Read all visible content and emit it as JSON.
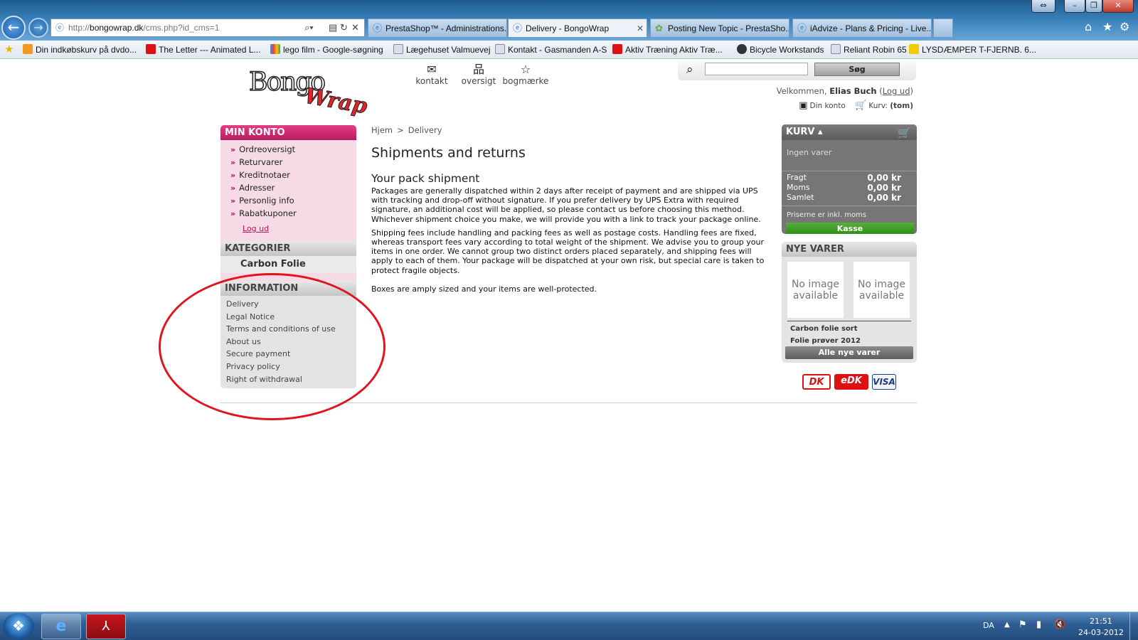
{
  "browser": {
    "address": {
      "prefix": "http://",
      "host": "bongowrap.dk",
      "path": "/cms.php?id_cms=1"
    },
    "tabs": [
      {
        "label": "PrestaShop™ - Administrations...",
        "active": false
      },
      {
        "label": "Delivery - BongoWrap",
        "active": true
      },
      {
        "label": "Posting New Topic - PrestaSho...",
        "active": false
      },
      {
        "label": "iAdvize - Plans & Pricing - Live...",
        "active": false
      }
    ],
    "favorites": [
      "Din indkøbskurv på dvdo...",
      "The Letter --- Animated L...",
      "lego film - Google-søgning",
      "Lægehuset Valmuevej",
      "Kontakt - Gasmanden A-S",
      "Aktiv Træning  Aktiv Træ...",
      "Bicycle Workstands",
      "Reliant Robin 65",
      "LYSDÆMPER T-FJERNB. 6..."
    ],
    "icons": [
      "back-icon",
      "forward-icon",
      "search-icon",
      "compatibility-icon",
      "refresh-icon",
      "stop-icon",
      "home-icon",
      "favorites-icon",
      "tools-icon"
    ]
  },
  "header": {
    "logo": {
      "part1": "Bongo",
      "part2": "Wrap"
    },
    "links": [
      {
        "label": "kontakt",
        "icon": "envelope-icon"
      },
      {
        "label": "oversigt",
        "icon": "sitemap-icon"
      },
      {
        "label": "bogmærke",
        "icon": "star-icon"
      }
    ],
    "search_button": "Søg",
    "search_value": "",
    "welcome_prefix": "Velkommen,",
    "user_name": "Elias Buch",
    "logout_label": "Log ud",
    "account_label": "Din konto",
    "cart_label": "Kurv:",
    "cart_value": "(tom)"
  },
  "left": {
    "min_konto": {
      "title": "MIN KONTO",
      "items": [
        "Ordreoversigt",
        "Returvarer",
        "Kreditnotaer",
        "Adresser",
        "Personlig info",
        "Rabatkuponer"
      ],
      "logout": "Log ud"
    },
    "kategorier": {
      "title": "KATEGORIER",
      "items": [
        "Carbon Folie"
      ]
    },
    "information": {
      "title": "INFORMATION",
      "items": [
        "Delivery",
        "Legal Notice",
        "Terms and conditions of use",
        "About us",
        "Secure payment",
        "Privacy policy",
        "Right of withdrawal"
      ]
    }
  },
  "breadcrumb": {
    "home": "Hjem",
    "separator": ">",
    "current": "Delivery"
  },
  "content": {
    "title": "Shipments and returns",
    "subtitle": "Your pack shipment",
    "paragraphs": [
      "Packages are generally dispatched within 2 days after receipt of payment and are shipped via UPS with tracking and drop-off without signature. If you prefer delivery by UPS Extra with required signature, an additional cost will be applied, so please contact us before choosing this method. Whichever shipment choice you make, we will provide you with a link to track your package online.",
      "Shipping fees include handling and packing fees as well as postage costs. Handling fees are fixed, whereas transport fees vary according to total weight of the shipment. We advise you to group your items in one order. We cannot group two distinct orders placed separately, and shipping fees will apply to each of them. Your package will be dispatched at your own risk, but special care is taken to protect fragile objects.",
      "Boxes are amply sized and your items are well-protected."
    ]
  },
  "cart_block": {
    "title": "KURV",
    "empty": "Ingen varer",
    "rows": [
      {
        "label": "Fragt",
        "value": "0,00 kr"
      },
      {
        "label": "Moms",
        "value": "0,00 kr"
      },
      {
        "label": "Samlet",
        "value": "0,00 kr"
      }
    ],
    "note": "Priserne er inkl. moms",
    "checkout": "Kasse"
  },
  "new_products": {
    "title": "NYE VARER",
    "no_image": "No image available",
    "items": [
      "Carbon folie sort",
      "Folie prøver 2012"
    ],
    "all_button": "Alle nye varer"
  },
  "payment_logos": [
    "DK",
    "eDK",
    "VISA"
  ],
  "colors": {
    "accent": "#c8186a",
    "annotation": "#e0141c",
    "checkout": "#3f9a24"
  },
  "taskbar": {
    "lang": "DA",
    "time": "21:51",
    "date": "24-03-2012"
  }
}
